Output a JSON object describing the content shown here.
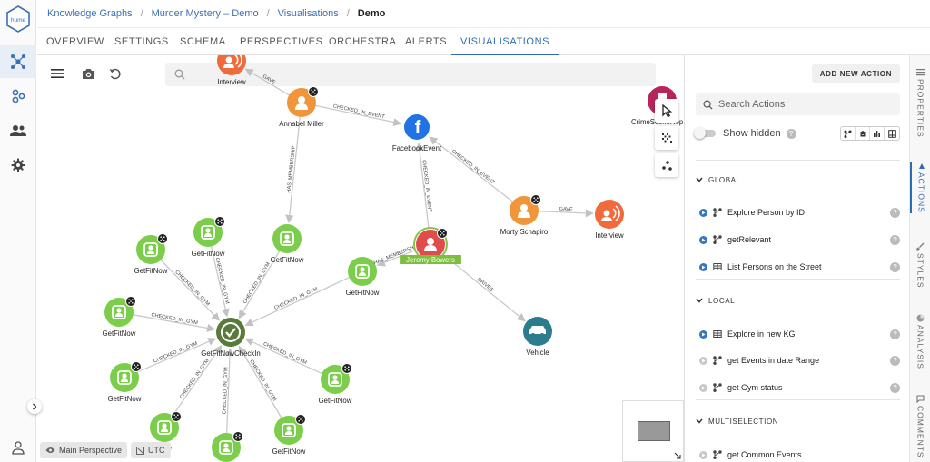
{
  "breadcrumb": [
    "Knowledge Graphs",
    "Murder Mystery – Demo",
    "Visualisations",
    "Demo"
  ],
  "logo_text": "hume",
  "tabs": [
    "OVERVIEW",
    "SETTINGS",
    "SCHEMA",
    "PERSPECTIVES",
    "ORCHESTRA",
    "ALERTS",
    "VISUALISATIONS"
  ],
  "active_tab": "VISUALISATIONS",
  "colors": {
    "accent": "#2f6cb3",
    "gym": "#7ccd4c",
    "person": "#f0953a",
    "suspect": "#e04b4b",
    "checkin": "#5a7a3c",
    "facebook": "#1f73e4",
    "vehicle": "#2b7d8d",
    "interview": "#f06a3c",
    "crimescene": "#b8245c"
  },
  "graph": {
    "nodes": [
      {
        "id": "interview_top",
        "label": "Interview",
        "kind": "interview"
      },
      {
        "id": "annabel",
        "label": "Annabel Miller",
        "kind": "person"
      },
      {
        "id": "facebook",
        "label": "FacebookEvent",
        "kind": "facebook"
      },
      {
        "id": "crimescene",
        "label": "CrimeSceneRep",
        "kind": "crimescene"
      },
      {
        "id": "morty",
        "label": "Morty Schapiro",
        "kind": "person"
      },
      {
        "id": "interview_right",
        "label": "Interview",
        "kind": "interview"
      },
      {
        "id": "jeremy",
        "label": "Jeremy Bowers",
        "kind": "suspect"
      },
      {
        "id": "vehicle",
        "label": "Vehicle",
        "kind": "vehicle"
      },
      {
        "id": "checkin",
        "label": "GetFitNowCheckIn",
        "kind": "checkin"
      },
      {
        "id": "g1",
        "label": "GetFitNow",
        "kind": "gym"
      },
      {
        "id": "g2",
        "label": "GetFitNow",
        "kind": "gym"
      },
      {
        "id": "g3",
        "label": "GetFitNow",
        "kind": "gym"
      },
      {
        "id": "g4",
        "label": "GetFitNow",
        "kind": "gym"
      },
      {
        "id": "g5",
        "label": "GetFitNow",
        "kind": "gym"
      },
      {
        "id": "g6",
        "label": "GetFitNow",
        "kind": "gym"
      },
      {
        "id": "g7",
        "label": "GetFitNow",
        "kind": "gym"
      },
      {
        "id": "g8",
        "label": "GetFitNow",
        "kind": "gym"
      },
      {
        "id": "g9",
        "label": "Now",
        "kind": "gym"
      },
      {
        "id": "g10",
        "label": "",
        "kind": "gym"
      }
    ],
    "edges": [
      {
        "from": "annabel",
        "to": "interview_top",
        "label": "GAVE"
      },
      {
        "from": "annabel",
        "to": "facebook",
        "label": "CHECKED_IN_EVENT"
      },
      {
        "from": "annabel",
        "to": "g2",
        "label": "HAS_MEMBERSHIP"
      },
      {
        "from": "jeremy",
        "to": "facebook",
        "label": "CHECKED_IN_EVENT"
      },
      {
        "from": "morty",
        "to": "facebook",
        "label": "CHECKED_IN_EVENT"
      },
      {
        "from": "morty",
        "to": "interview_right",
        "label": "GAVE"
      },
      {
        "from": "jeremy",
        "to": "g3",
        "label": "HAS_MEMBERSHIP"
      },
      {
        "from": "jeremy",
        "to": "vehicle",
        "label": "DRIVES"
      },
      {
        "from": "g1",
        "to": "checkin",
        "label": "CHECKED_IN_GYM"
      },
      {
        "from": "g4",
        "to": "checkin",
        "label": "CHECKED_IN_GYM"
      },
      {
        "from": "g2",
        "to": "checkin",
        "label": "CHECKED_IN_GYM"
      },
      {
        "from": "g3",
        "to": "checkin",
        "label": "CHECKED_IN_GYM"
      },
      {
        "from": "g5",
        "to": "checkin",
        "label": "CHECKED_IN_GYM"
      },
      {
        "from": "g6",
        "to": "checkin",
        "label": "CHECKED_IN_GYM"
      },
      {
        "from": "g7",
        "to": "checkin",
        "label": "CHECKED_IN_GYM"
      },
      {
        "from": "g8",
        "to": "checkin",
        "label": "CHECKED_IN_GYM"
      },
      {
        "from": "g9",
        "to": "checkin",
        "label": "CHECKED_IN_GYM"
      },
      {
        "from": "g10",
        "to": "checkin",
        "label": "CHECKED_IN_GYM"
      }
    ]
  },
  "canvas": {
    "perspective_chip": "Main Perspective",
    "timezone_chip": "UTC"
  },
  "actions_panel": {
    "add_button": "ADD NEW ACTION",
    "search_placeholder": "Search Actions",
    "show_hidden_label": "Show hidden",
    "sections": [
      {
        "title": "GLOBAL",
        "items": [
          {
            "label": "Explore Person by ID",
            "type": "graph",
            "enabled": true
          },
          {
            "label": "getRelevant",
            "type": "graph",
            "enabled": true
          },
          {
            "label": "List Persons on the Street",
            "type": "table",
            "enabled": true
          }
        ]
      },
      {
        "title": "LOCAL",
        "items": [
          {
            "label": "Explore in new KG",
            "type": "table",
            "enabled": true
          },
          {
            "label": "get Events in date Range",
            "type": "graph",
            "enabled": false
          },
          {
            "label": "get Gym status",
            "type": "graph",
            "enabled": false
          }
        ]
      },
      {
        "title": "MULTISELECTION",
        "items": [
          {
            "label": "get Common Events",
            "type": "graph",
            "enabled": false
          }
        ]
      }
    ]
  },
  "side_tabs": [
    "PROPERTIES",
    "ACTIONS",
    "STYLES",
    "ANALYSIS",
    "COMMENTS"
  ],
  "active_side_tab": "ACTIONS"
}
